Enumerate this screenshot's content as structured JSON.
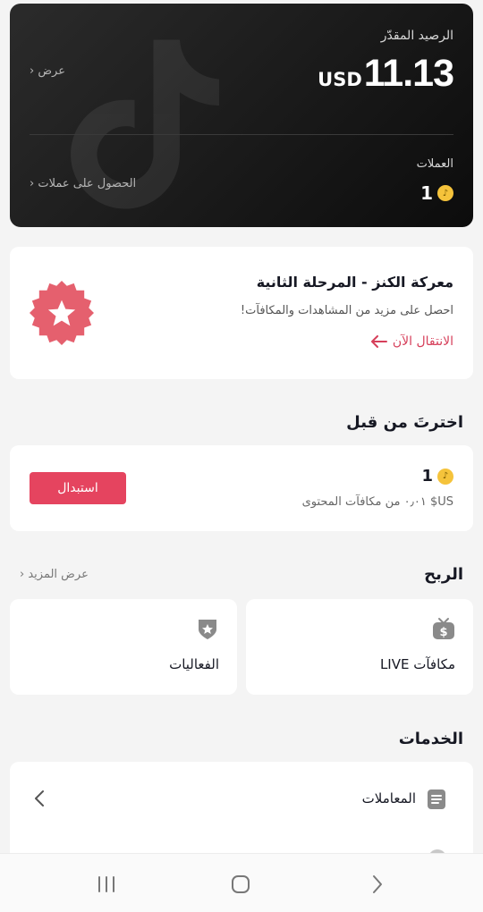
{
  "balance": {
    "label": "الرصيد المقدّر",
    "currency": "USD",
    "amount": "11.13",
    "view_label": "عرض",
    "coins_label": "العملات",
    "coins_value": "1",
    "get_coins_label": "الحصول على عملات"
  },
  "promo": {
    "title": "معركة الكنز - المرحلة الثانية",
    "subtitle": "احصل على مزيد من المشاهدات والمكافآت!",
    "link": "الانتقال الآن",
    "accent_color": "#e5445f"
  },
  "redeemed": {
    "title": "اخترتَ من قبل",
    "coins_value": "1",
    "subtitle": "US$ ٠٫٠١ من مكافآت المحتوى",
    "button": "استبدال"
  },
  "earnings": {
    "title": "الربح",
    "more_label": "عرض المزيد",
    "items": [
      {
        "label": "مكافآت LIVE",
        "icon": "dollar-tv-icon"
      },
      {
        "label": "الفعاليات",
        "icon": "shield-star-icon"
      }
    ]
  },
  "services": {
    "title": "الخدمات",
    "items": [
      {
        "label": "المعاملات",
        "icon": "document-list-icon"
      }
    ]
  },
  "nav": {
    "recent": "recent-apps-icon",
    "home": "home-icon",
    "back": "back-icon"
  }
}
